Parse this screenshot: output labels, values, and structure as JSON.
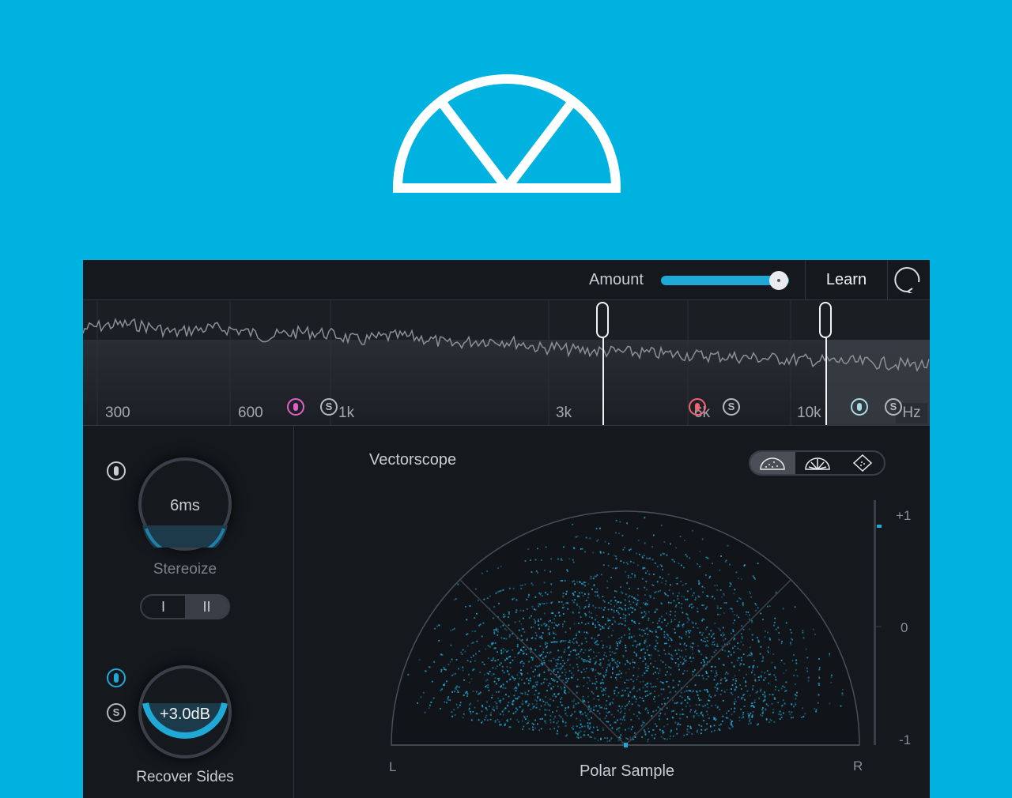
{
  "brand": {
    "logo_icon": "imager-half-circle-logo-icon",
    "background": "#00b2df"
  },
  "topbar": {
    "amount_label": "Amount",
    "amount_value": 0.92,
    "learn_label": "Learn",
    "reset_icon": "rotate-reset-icon"
  },
  "spectrum": {
    "freq_labels": [
      "300",
      "600",
      "1k",
      "3k",
      "6k",
      "10k"
    ],
    "unit": "Hz"
  },
  "left_panel": {
    "stereoize": {
      "value": "6ms",
      "label": "Stereoize",
      "fill": 0.25
    },
    "mode_toggle": {
      "options": [
        "I",
        "II"
      ],
      "selected": "II"
    },
    "recover_sides": {
      "value": "+3.0dB",
      "label": "Recover Sides",
      "fill": 0.6
    }
  },
  "scope": {
    "title": "Vectorscope",
    "modes": [
      "polar-sample-icon",
      "polar-level-icon",
      "lissajous-icon"
    ],
    "selected_mode": "polar-sample-icon",
    "mode_label": "Polar Sample",
    "left_label": "L",
    "right_label": "R",
    "meter": {
      "top": "+1",
      "mid": "0",
      "bottom": "-1",
      "value": 0.8
    },
    "accent": "#1fa9d7"
  }
}
